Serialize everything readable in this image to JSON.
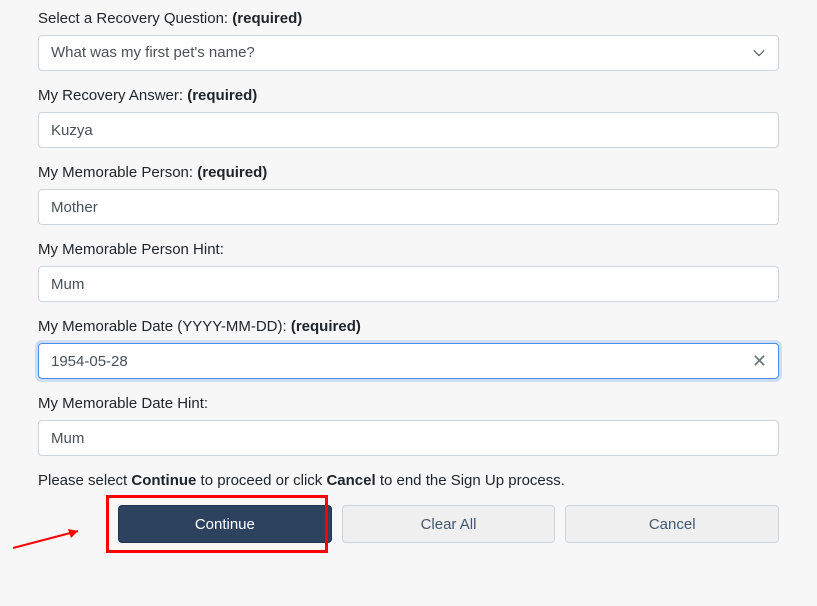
{
  "fields": {
    "question": {
      "label": "Select a Recovery Question:",
      "required_suffix": "(required)",
      "value": "What was my first pet's name?"
    },
    "answer": {
      "label": "My Recovery Answer:",
      "required_suffix": "(required)",
      "value": "Kuzya"
    },
    "person": {
      "label": "My Memorable Person:",
      "required_suffix": "(required)",
      "value": "Mother"
    },
    "person_hint": {
      "label": "My Memorable Person Hint:",
      "value": "Mum"
    },
    "date": {
      "label": "My Memorable Date (YYYY-MM-DD):",
      "required_suffix": "(required)",
      "value": "1954-05-28"
    },
    "date_hint": {
      "label": "My Memorable Date Hint:",
      "value": "Mum"
    }
  },
  "helper": {
    "pre": "Please select ",
    "b1": "Continue",
    "mid": " to proceed or click ",
    "b2": "Cancel",
    "post": " to end the Sign Up process."
  },
  "buttons": {
    "continue": "Continue",
    "clear_all": "Clear All",
    "cancel": "Cancel"
  },
  "icons": {
    "clear_x": "✕"
  }
}
